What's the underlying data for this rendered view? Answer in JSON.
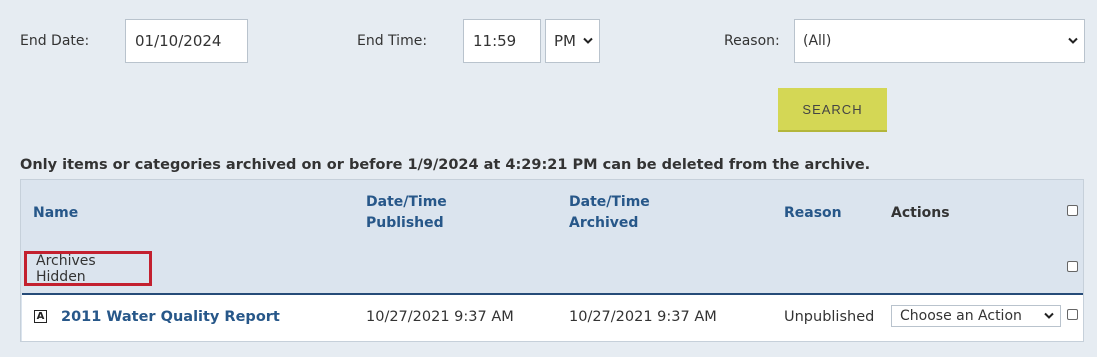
{
  "filters": {
    "end_date_label": "End Date:",
    "end_date_value": "01/10/2024",
    "end_time_label": "End Time:",
    "end_time_value": "11:59",
    "ampm_value": "PM",
    "reason_label": "Reason:",
    "reason_value": "(All)",
    "search_label": "SEARCH"
  },
  "notice": "Only items or categories archived on or before 1/9/2024 at 4:29:21 PM can be deleted from the archive.",
  "table": {
    "headers": {
      "name": "Name",
      "published_line1": "Date/Time",
      "published_line2": "Published",
      "archived_line1": "Date/Time",
      "archived_line2": "Archived",
      "reason": "Reason",
      "actions": "Actions"
    },
    "group_label": "Archives Hidden",
    "rows": [
      {
        "icon": "A",
        "name": "2011 Water Quality Report",
        "published": "10/27/2021 9:37 AM",
        "archived": "10/27/2021 9:37 AM",
        "reason": "Unpublished",
        "action_value": "Choose an Action"
      }
    ]
  },
  "colors": {
    "background": "#e6ecf2",
    "search_button": "#d4d755",
    "header_link": "#275789",
    "highlight_border": "#c3202f"
  }
}
